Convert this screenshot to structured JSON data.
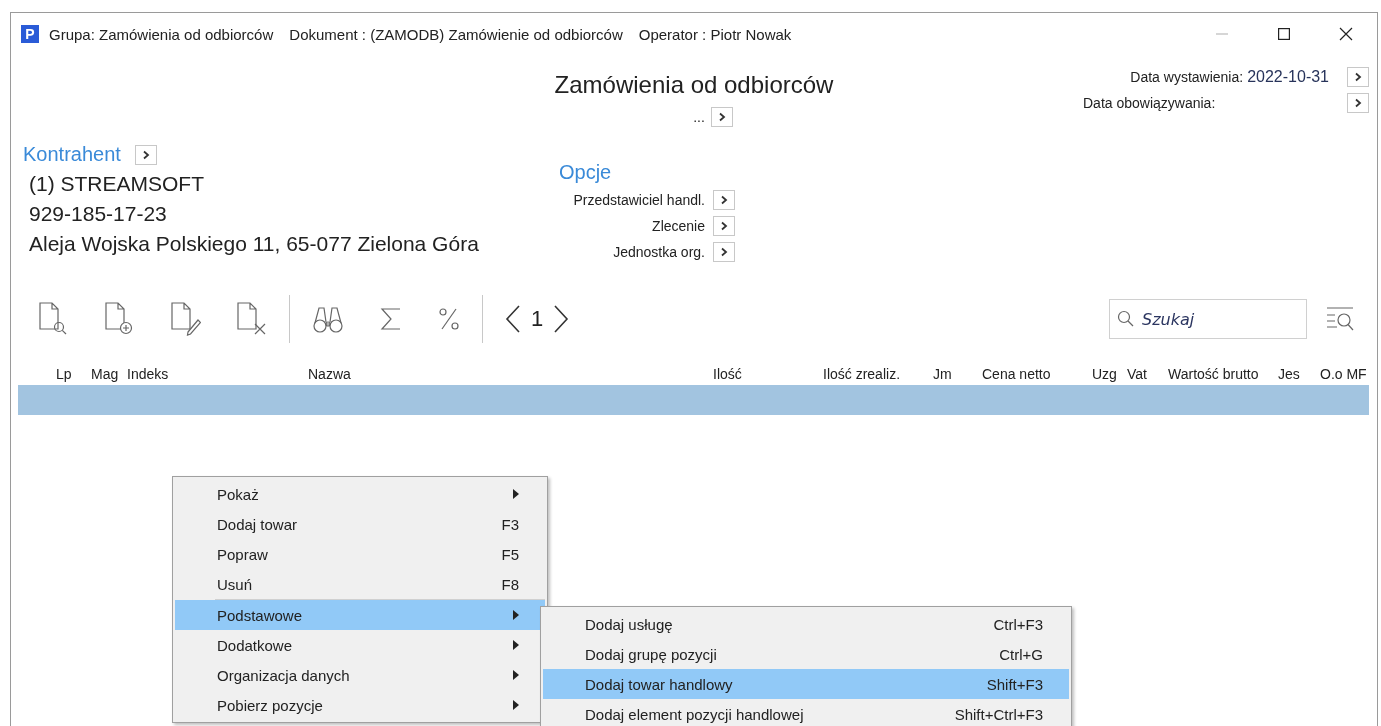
{
  "window": {
    "icon_letter": "P",
    "title_parts": [
      "Grupa: Zamówienia od odbiorców",
      "Dokument : (ZAMODB) Zamówienie od odbiorców",
      "Operator : Piotr Nowak"
    ]
  },
  "header": {
    "title": "Zamówienia od odbiorców",
    "number": "...",
    "dates": [
      {
        "label": "Data wystawienia:",
        "value": "2022-10-31"
      },
      {
        "label": "Data obowiązywania:"
      }
    ]
  },
  "contractor": {
    "heading": "Kontrahent",
    "lines": [
      "(1) STREAMSOFT",
      "929-185-17-23",
      "Aleja Wojska Polskiego 11, 65-077 Zielona Góra"
    ]
  },
  "options": {
    "heading": "Opcje",
    "items": [
      "Przedstawiciel handl.",
      "Zlecenie",
      "Jednostka org."
    ]
  },
  "toolbar": {
    "page": "1",
    "search": {
      "placeholder": "Szukaj"
    }
  },
  "table": {
    "columns": [
      "Lp",
      "Mag",
      "Indeks",
      "Nazwa",
      "Ilość",
      "Ilość zrealiz.",
      "Jm",
      "Cena netto",
      "Uzg",
      "Vat",
      "Wartość brutto",
      "Jes",
      "O.o MF"
    ],
    "rows": [
      {
        "selected": true
      }
    ]
  },
  "context_menu": {
    "items": [
      {
        "kind": "item",
        "label": "Pokaż",
        "has_submenu": true,
        "selected": false
      },
      {
        "kind": "item",
        "label": "Dodaj towar",
        "shortcut": "F3",
        "has_submenu": false,
        "selected": false
      },
      {
        "kind": "item",
        "label": "Popraw",
        "shortcut": "F5",
        "has_submenu": false,
        "selected": false
      },
      {
        "kind": "item",
        "label": "Usuń",
        "shortcut": "F8",
        "has_submenu": false,
        "selected": false
      },
      {
        "kind": "separator"
      },
      {
        "kind": "item",
        "label": "Podstawowe",
        "has_submenu": true,
        "selected": true
      },
      {
        "kind": "item",
        "label": "Dodatkowe",
        "has_submenu": true,
        "selected": false
      },
      {
        "kind": "item",
        "label": "Organizacja danych",
        "has_submenu": true,
        "selected": false
      },
      {
        "kind": "item",
        "label": "Pobierz pozycje",
        "has_submenu": true,
        "selected": false
      }
    ],
    "submenu": {
      "items": [
        {
          "label": "Dodaj usługę",
          "shortcut": "Ctrl+F3",
          "selected": false
        },
        {
          "label": "Dodaj grupę pozycji",
          "shortcut": "Ctrl+G",
          "selected": false
        },
        {
          "label": "Dodaj towar handlowy",
          "shortcut": "Shift+F3",
          "selected": true
        },
        {
          "label": "Dodaj element pozycji handlowej",
          "shortcut": "Shift+Ctrl+F3",
          "selected": false
        }
      ]
    }
  }
}
